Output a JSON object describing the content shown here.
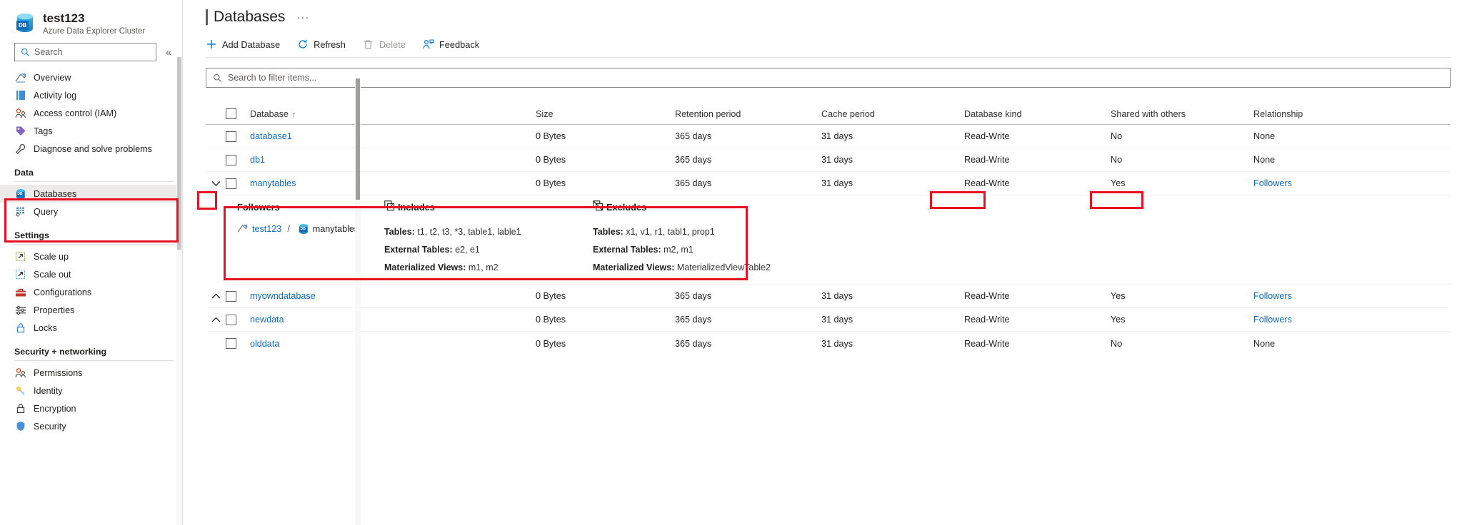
{
  "sidebar": {
    "resource_name": "test123",
    "resource_type": "Azure Data Explorer Cluster",
    "logo_text": "DB",
    "search_placeholder": "Search",
    "collapse_label": "«",
    "items": [
      {
        "label": "Overview",
        "icon": "overview-icon"
      },
      {
        "label": "Activity log",
        "icon": "activity-log-icon"
      },
      {
        "label": "Access control (IAM)",
        "icon": "access-control-icon"
      },
      {
        "label": "Tags",
        "icon": "tag-icon"
      },
      {
        "label": "Diagnose and solve problems",
        "icon": "wrench-icon"
      }
    ],
    "groups": [
      {
        "title": "Data",
        "items": [
          {
            "label": "Databases",
            "icon": "database-icon",
            "active": true
          },
          {
            "label": "Query",
            "icon": "query-grid-icon",
            "active": false
          }
        ]
      },
      {
        "title": "Settings",
        "items": [
          {
            "label": "Scale up",
            "icon": "scale-up-icon",
            "active": false
          },
          {
            "label": "Scale out",
            "icon": "scale-out-icon",
            "active": false
          },
          {
            "label": "Configurations",
            "icon": "toolbox-icon",
            "active": false
          },
          {
            "label": "Properties",
            "icon": "sliders-icon",
            "active": false
          },
          {
            "label": "Locks",
            "icon": "lock-icon",
            "active": false
          }
        ]
      },
      {
        "title": "Security + networking",
        "items": [
          {
            "label": "Permissions",
            "icon": "permissions-icon",
            "active": false
          },
          {
            "label": "Identity",
            "icon": "key-icon",
            "active": false
          },
          {
            "label": "Encryption",
            "icon": "padlock-icon",
            "active": false
          },
          {
            "label": "Security",
            "icon": "shield-icon",
            "active": false
          }
        ]
      }
    ]
  },
  "header": {
    "title": "Databases",
    "more_label": "···"
  },
  "toolbar": {
    "add_database": "Add Database",
    "refresh": "Refresh",
    "delete": "Delete",
    "feedback": "Feedback"
  },
  "filter": {
    "placeholder": "Search to filter items..."
  },
  "grid": {
    "columns": [
      "Database",
      "Size",
      "Retention period",
      "Cache period",
      "Database kind",
      "Shared with others",
      "Relationship"
    ],
    "sort_indicator": "↑",
    "rows": [
      {
        "name": "database1",
        "size": "0 Bytes",
        "retention": "365 days",
        "cache": "31 days",
        "kind": "Read-Write",
        "shared": "No",
        "relationship": "None",
        "chevron": "",
        "expanded": false
      },
      {
        "name": "db1",
        "size": "0 Bytes",
        "retention": "365 days",
        "cache": "31 days",
        "kind": "Read-Write",
        "shared": "No",
        "relationship": "None",
        "chevron": "",
        "expanded": false
      },
      {
        "name": "manytables",
        "size": "0 Bytes",
        "retention": "365 days",
        "cache": "31 days",
        "kind": "Read-Write",
        "shared": "Yes",
        "relationship": "Followers",
        "chevron": "⌄",
        "expanded": true
      },
      {
        "name": "myowndatabase",
        "size": "0 Bytes",
        "retention": "365 days",
        "cache": "31 days",
        "kind": "Read-Write",
        "shared": "Yes",
        "relationship": "Followers",
        "chevron": "⌃",
        "expanded": false
      },
      {
        "name": "newdata",
        "size": "0 Bytes",
        "retention": "365 days",
        "cache": "31 days",
        "kind": "Read-Write",
        "shared": "Yes",
        "relationship": "Followers",
        "chevron": "⌃",
        "expanded": false
      },
      {
        "name": "olddata",
        "size": "0 Bytes",
        "retention": "365 days",
        "cache": "31 days",
        "kind": "Read-Write",
        "shared": "No",
        "relationship": "None",
        "chevron": "",
        "expanded": false
      }
    ]
  },
  "detail_panel": {
    "followers_header": "Followers",
    "includes_header": "Includes",
    "excludes_header": "Excludes",
    "follower_cluster": "test123",
    "follower_separator": "/",
    "follower_database": "manytables",
    "includes": [
      {
        "key": "Tables:",
        "value": "t1, t2, t3, *3, table1, lable1"
      },
      {
        "key": "External Tables:",
        "value": "e2, e1"
      },
      {
        "key": "Materialized Views:",
        "value": "m1, m2"
      }
    ],
    "excludes": [
      {
        "key": "Tables:",
        "value": "x1, v1, r1, tabl1, prop1"
      },
      {
        "key": "External Tables:",
        "value": "m2, m1"
      },
      {
        "key": "Materialized Views:",
        "value": "MaterializedViewTable2"
      }
    ]
  },
  "highlight_color": "#e81123",
  "accent_color": "#0078d4",
  "link_color": "#0f6cbd"
}
